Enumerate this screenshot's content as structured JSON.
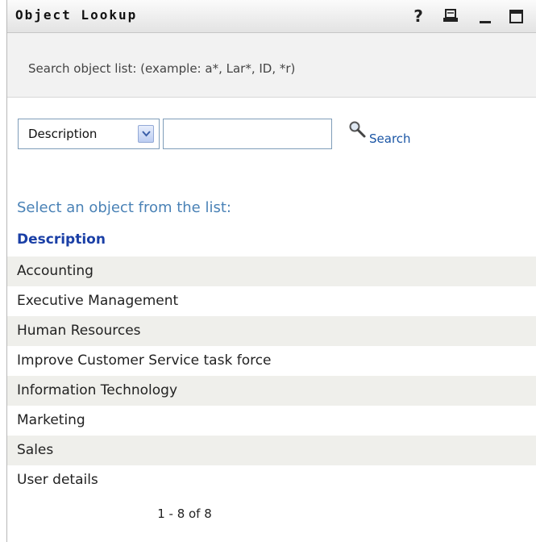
{
  "window": {
    "title": "Object Lookup",
    "help_symbol": "?",
    "icons": [
      "help-icon",
      "print-icon",
      "minimize-icon",
      "maximize-icon"
    ]
  },
  "search": {
    "hint": "Search object list: (example: a*, Lar*, ID, *r)",
    "field_selected": "Description",
    "query_value": "",
    "button_label": "Search",
    "button_icon": "magnifier-icon"
  },
  "list": {
    "title": "Select an object from the list:",
    "column_header": "Description",
    "items": [
      "Accounting",
      "Executive Management",
      "Human Resources",
      "Improve Customer Service task force",
      "Information Technology",
      "Marketing",
      "Sales",
      "User details"
    ],
    "pager": "1 - 8 of 8"
  },
  "colors": {
    "link": "#1a55a5",
    "section_title": "#4a82b6",
    "column_header": "#1a3fa6",
    "row_stripe": "#efefeb"
  }
}
